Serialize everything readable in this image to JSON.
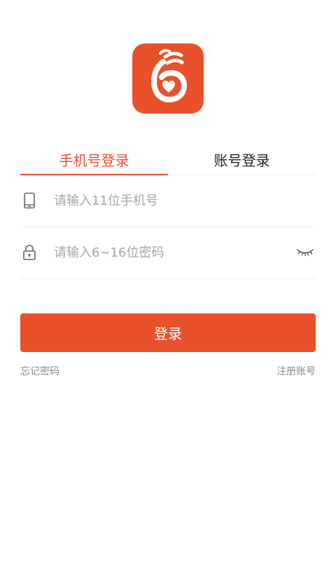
{
  "logo": {
    "icon": "app-logo-icon",
    "color": "#e8512a"
  },
  "tabs": [
    {
      "label": "手机号登录",
      "active": true
    },
    {
      "label": "账号登录",
      "active": false
    }
  ],
  "phone_field": {
    "icon": "phone-icon",
    "placeholder": "请输入11位手机号",
    "value": ""
  },
  "password_field": {
    "icon": "lock-icon",
    "placeholder": "请输入6~16位密码",
    "value": "",
    "toggle_icon": "eye-closed-icon"
  },
  "login_button": {
    "label": "登录"
  },
  "links": {
    "forgot_password": "忘记密码",
    "register": "注册账号"
  },
  "colors": {
    "accent": "#e8512a",
    "placeholder": "#a6a6a6",
    "divider": "#eeeeee",
    "muted_text": "#8a8a8a"
  }
}
